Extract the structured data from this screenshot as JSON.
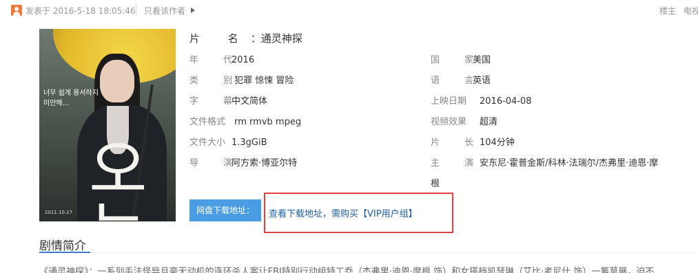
{
  "post": {
    "date_label": "发表于 2016-5-18 18:05:46",
    "only_author": "只看该作者",
    "floor_label": "楼主",
    "tv_label": "电视"
  },
  "poster": {
    "kr_line1": "너무 쉽게 용서하지",
    "kr_line2": "미안해...",
    "title_art": "오늘",
    "date": "2011.10.27"
  },
  "movie": {
    "name_label": "片  名",
    "name_value": "通灵神探",
    "left": [
      {
        "label": "年 代",
        "value": "2016"
      },
      {
        "label": "类 别",
        "value": " 犯罪 惊悚 冒险"
      },
      {
        "label": "字 幕",
        "value": "中文简体"
      },
      {
        "label": "文件格式",
        "value": " rm rmvb mpeg"
      },
      {
        "label": "文件大小",
        "value": "1.3gGiB"
      },
      {
        "label": "导 演",
        "value": "阿方索·博亚尔特"
      }
    ],
    "right": [
      {
        "label": "国 家",
        "value": "美国"
      },
      {
        "label": "语 言",
        "value": "英语"
      },
      {
        "label": "上映日期",
        "value": "2016-04-08"
      },
      {
        "label": "视频效果",
        "value": "超清"
      },
      {
        "label": "片 长",
        "value": "104分钟"
      },
      {
        "label": "主 演",
        "value": "安东尼·霍普金斯/科林·法瑞尔/杰弗里·迪恩·摩"
      }
    ],
    "cast_continuation": "根"
  },
  "download": {
    "button_label": "网盘下载地址：",
    "link_text": "查看下载地址，需购买【VIP用户组】"
  },
  "plot": {
    "section_title": "剧情简介",
    "text": "《通灵神探》：一系列手法怪异且毫无动机的连环杀人案让FBI特别行动组特工乔（杰弗里·迪恩·摩根 饰）和女搭档凯瑟琳（艾比·考尼什 饰）一筹莫展，迫不"
  },
  "colors": {
    "accent_blue": "#4a9de2",
    "highlight_red": "#e04040",
    "link_blue": "#1f5fa6"
  }
}
